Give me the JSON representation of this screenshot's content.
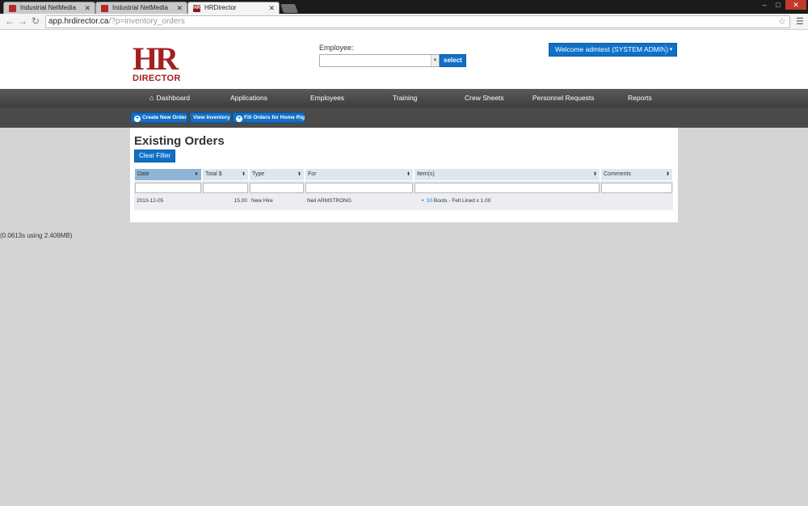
{
  "browser": {
    "tabs": [
      {
        "title": "Industrial NetMedia"
      },
      {
        "title": "Industrial NetMedia"
      },
      {
        "title": "HRDirector"
      }
    ],
    "url_host": "app.hrdirector.ca",
    "url_path": "/?p=inventory_orders"
  },
  "header": {
    "logo_letters": "HR",
    "logo_word": "DIRECTOR",
    "employee_label": "Employee:",
    "select_label": "select",
    "welcome_label": "Welcome admtest (SYSTEM ADMIN)"
  },
  "nav": {
    "items": [
      "Dashboard",
      "Applications",
      "Employees",
      "Training",
      "Crew Sheets",
      "Personnel Requests",
      "Reports"
    ]
  },
  "subnav": {
    "create": "Create New Order",
    "view": "View Inventory",
    "fill": "Fill Orders for Home Rig"
  },
  "main": {
    "title": "Existing Orders",
    "clear_filter": "Clear Filter",
    "columns": [
      "Date",
      "Total $",
      "Type",
      "For",
      "Item(s)",
      "Comments"
    ],
    "rows": [
      {
        "date": "2013-12-05",
        "total": "15.00",
        "type": "New Hire",
        "for": "Neil ARMSTRONG",
        "item_qty": "10",
        "item_desc": " Boots - Felt Lined x 1.00",
        "comments": ""
      }
    ]
  },
  "footer_note": "(0.0613s using 2.409MB)"
}
